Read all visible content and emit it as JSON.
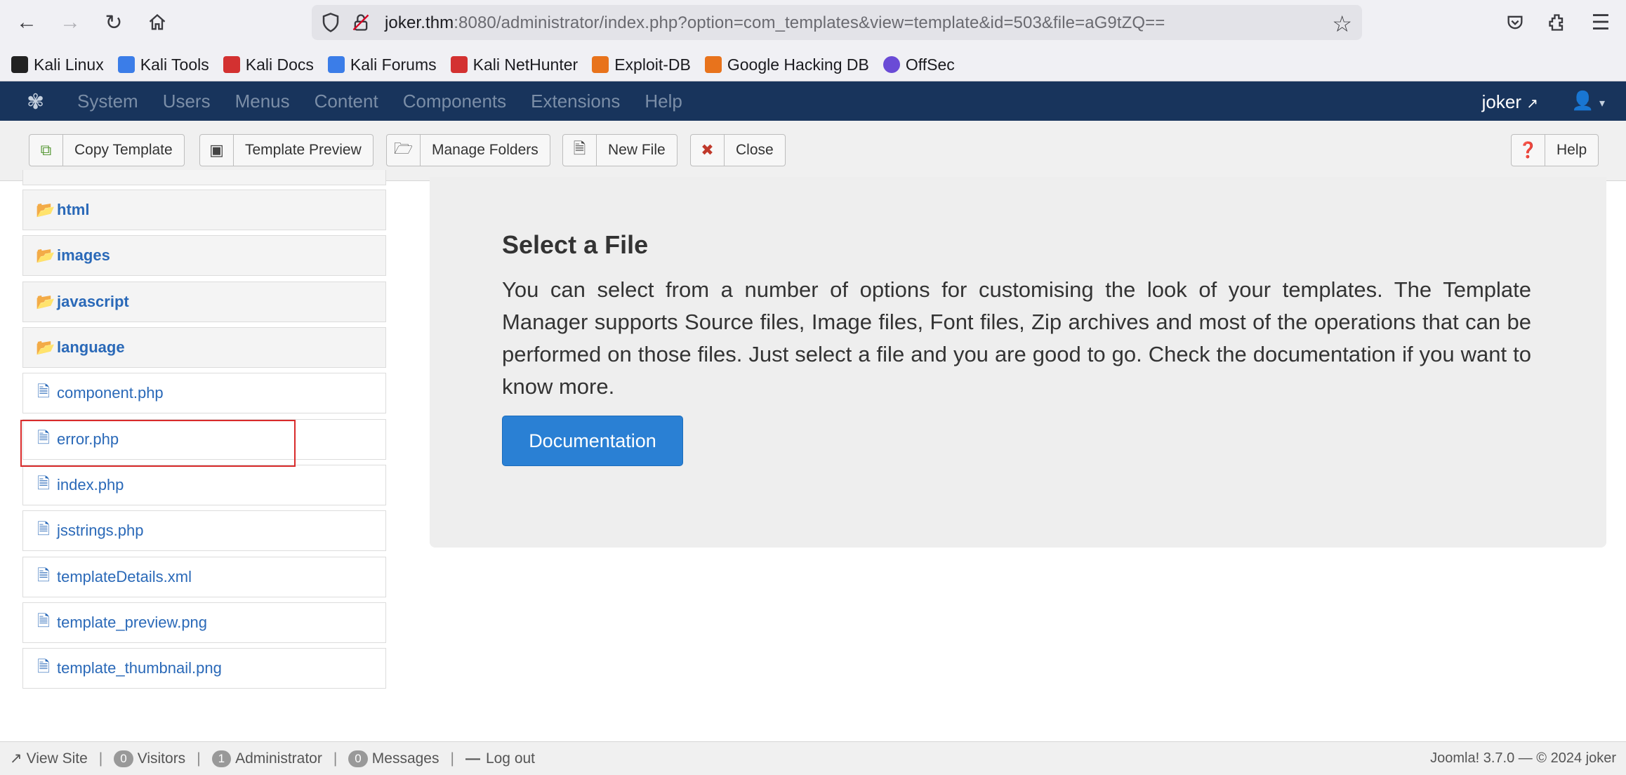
{
  "browser": {
    "url_host": "joker.thm",
    "url_rest": ":8080/administrator/index.php?option=com_templates&view=template&id=503&file=aG9tZQ==",
    "bookmarks": [
      {
        "label": "Kali Linux",
        "color": "#222222"
      },
      {
        "label": "Kali Tools",
        "color": "#3b7de8"
      },
      {
        "label": "Kali Docs",
        "color": "#d33131"
      },
      {
        "label": "Kali Forums",
        "color": "#3b7de8"
      },
      {
        "label": "Kali NetHunter",
        "color": "#d33131"
      },
      {
        "label": "Exploit-DB",
        "color": "#e8731c"
      },
      {
        "label": "Google Hacking DB",
        "color": "#e8731c"
      },
      {
        "label": "OffSec",
        "color": "#6a4bd6"
      }
    ]
  },
  "joomla_nav": {
    "menu": [
      "System",
      "Users",
      "Menus",
      "Content",
      "Components",
      "Extensions",
      "Help"
    ],
    "user": "joker"
  },
  "toolbar": {
    "copy_template": "Copy Template",
    "template_preview": "Template Preview",
    "manage_folders": "Manage Folders",
    "new_file": "New File",
    "close": "Close",
    "help": "Help"
  },
  "tree": {
    "folders": [
      "html",
      "images",
      "javascript",
      "language"
    ],
    "files": [
      "component.php",
      "error.php",
      "index.php",
      "jsstrings.php",
      "templateDetails.xml",
      "template_preview.png",
      "template_thumbnail.png"
    ]
  },
  "main": {
    "title": "Select a File",
    "description": "You can select from a number of options for customising the look of your templates. The Template Manager supports Source files, Image files, Font files, Zip archives and most of the operations that can be performed on those files. Just select a file and you are good to go. Check the documentation if you want to know more.",
    "documentation_button": "Documentation"
  },
  "footer": {
    "view_site": "View Site",
    "visitors_count": "0",
    "visitors_label": "Visitors",
    "admin_count": "1",
    "admin_label": "Administrator",
    "messages_count": "0",
    "messages_label": "Messages",
    "logout": "Log out",
    "version": "Joomla! 3.7.0 — © 2024 joker"
  }
}
